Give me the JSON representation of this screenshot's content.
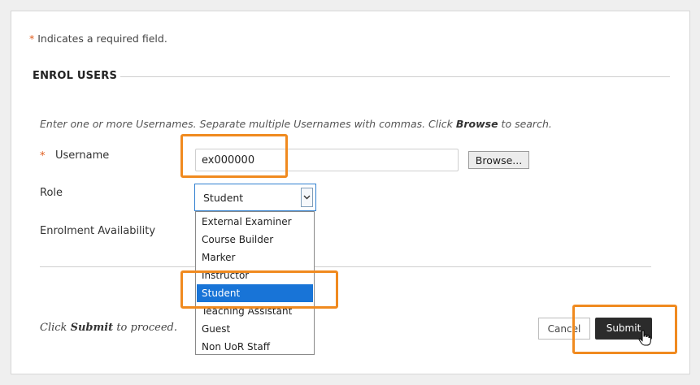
{
  "required_note": {
    "star": "*",
    "text": "Indicates a required field."
  },
  "section": {
    "title": "ENROL USERS"
  },
  "instructions": {
    "before": "Enter one or more Usernames. Separate multiple Usernames with commas. Click ",
    "bold": "Browse",
    "after": " to search."
  },
  "form": {
    "username_star": "*",
    "username_label": "Username",
    "username_value": "ex000000",
    "browse_label": "Browse...",
    "role_label": "Role",
    "role_value": "Student",
    "availability_label": "Enrolment Availability"
  },
  "role_options": [
    "External Examiner",
    "Course Builder",
    "Marker",
    "Instructor",
    "Student",
    "Teaching Assistant",
    "Guest",
    "Non UoR Staff"
  ],
  "footer": {
    "proceed_before": "Click ",
    "proceed_bold": "Submit",
    "proceed_after": " to proceed.",
    "cancel_label": "Cancel",
    "submit_label": "Submit"
  },
  "colors": {
    "highlight": "#f08a1f",
    "selected_option": "#1874d7",
    "required_star": "#e05d1e",
    "submit_bg": "#2b2b2b"
  }
}
